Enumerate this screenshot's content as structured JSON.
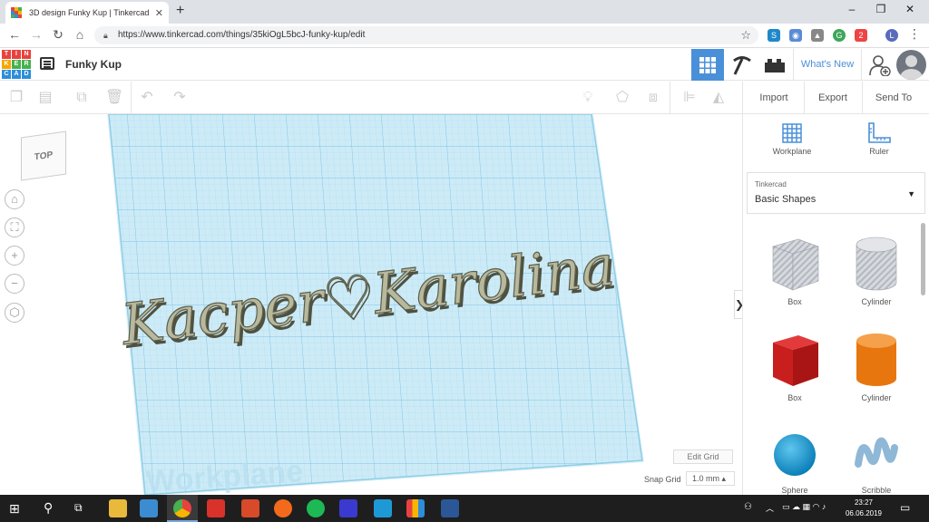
{
  "browser": {
    "tab_title": "3D design Funky Kup | Tinkercad",
    "tab_close": "✕",
    "new_tab": "+",
    "url": "https://www.tinkercad.com/things/35kiOgL5bcJ-funky-kup/edit",
    "window_controls": [
      "–",
      "❐",
      "✕"
    ],
    "extension_badge": "2",
    "profile_initial": "L"
  },
  "header": {
    "logo_letters": [
      "T",
      "I",
      "N",
      "K",
      "E",
      "R",
      "C",
      "A",
      "D"
    ],
    "design_title": "Funky Kup",
    "whats_new": "What's New"
  },
  "toolbar": {
    "import": "Import",
    "export": "Export",
    "send_to": "Send To"
  },
  "workspace": {
    "view_cube": "TOP",
    "design_text": "Kacper♡Karolina",
    "workplane_watermark": "Workplane",
    "edit_grid": "Edit Grid",
    "snap_grid_label": "Snap Grid",
    "snap_grid_value": "1.0 mm ▴"
  },
  "panel": {
    "workplane": "Workplane",
    "ruler": "Ruler",
    "library_source": "Tinkercad",
    "library_name": "Basic Shapes",
    "shapes": [
      "Box",
      "Cylinder",
      "Box",
      "Cylinder",
      "Sphere",
      "Scribble"
    ]
  },
  "taskbar": {
    "time": "23:27",
    "date": "06.06.2019"
  },
  "colors": {
    "accent": "#4a90d9",
    "grid": "#bfe3f2",
    "text_shape": "#b8b89c"
  }
}
